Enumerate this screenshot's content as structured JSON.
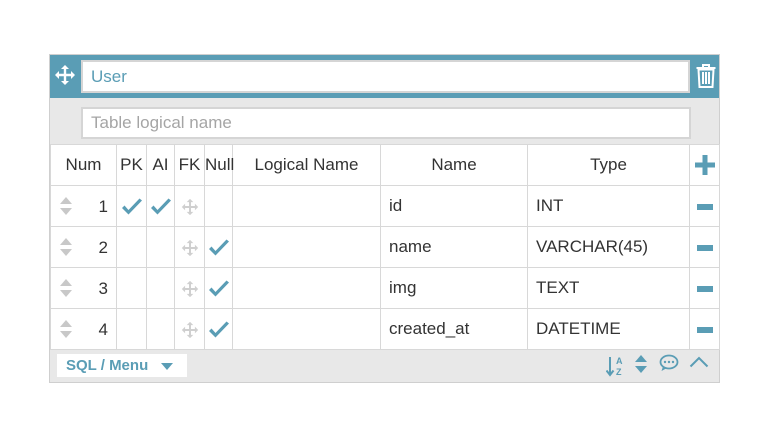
{
  "table": {
    "name": "User",
    "logical_name_placeholder": "Table logical name"
  },
  "columns_header": {
    "num": "Num",
    "pk": "PK",
    "ai": "AI",
    "fk": "FK",
    "null": "Null",
    "logical_name": "Logical Name",
    "name": "Name",
    "type": "Type"
  },
  "rows": [
    {
      "num": "1",
      "pk": true,
      "ai": true,
      "fk": false,
      "null": false,
      "logical_name": "",
      "name": "id",
      "type": "INT"
    },
    {
      "num": "2",
      "pk": false,
      "ai": false,
      "fk": false,
      "null": true,
      "logical_name": "",
      "name": "name",
      "type": "VARCHAR(45)"
    },
    {
      "num": "3",
      "pk": false,
      "ai": false,
      "fk": false,
      "null": true,
      "logical_name": "",
      "name": "img",
      "type": "TEXT"
    },
    {
      "num": "4",
      "pk": false,
      "ai": false,
      "fk": false,
      "null": true,
      "logical_name": "",
      "name": "created_at",
      "type": "DATETIME"
    }
  ],
  "bottom_bar": {
    "sql_menu_label": "SQL / Menu"
  },
  "icons": {
    "title_left": "move-icon",
    "title_right": "trash-icon",
    "row_handle": "sort-handle-icon",
    "check": "check-icon",
    "fk": "fk-move-icon",
    "add": "plus-icon",
    "remove": "minus-icon",
    "dropdown": "caret-down-icon",
    "sort": "sort-az-icon",
    "reorder": "up-down-icon",
    "comment": "comment-icon",
    "collapse": "chevron-up-icon"
  },
  "colors": {
    "accent": "#5a9db5",
    "panel": "#e8e8e8",
    "border": "#d8d8d8",
    "muted_icon": "#c8c8c8"
  }
}
